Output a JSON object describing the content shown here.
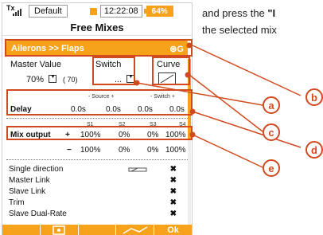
{
  "statusbar": {
    "tx_label": "Tx",
    "model": "Default",
    "time": "12:22:08",
    "battery": "64%"
  },
  "screen_title": "Free Mixes",
  "mix": {
    "name": "Ailerons >> Flaps",
    "suffix": "⊛G"
  },
  "master": {
    "label": "Master Value",
    "value": "70%",
    "extra": "( 70)"
  },
  "switch": {
    "label": "Switch",
    "value": "..."
  },
  "curve": {
    "label": "Curve"
  },
  "delay": {
    "source_header": "- Source +",
    "switch_header": "- Switch +",
    "label": "Delay",
    "values": [
      "0.0s",
      "0.0s",
      "0.0s",
      "0.0s"
    ]
  },
  "mix_output": {
    "headers": [
      "S1",
      "S2",
      "S3",
      "S4"
    ],
    "label": "Mix output",
    "plus_sign": "+",
    "minus_sign": "−",
    "plus": [
      "100%",
      "0%",
      "0%",
      "100%"
    ],
    "minus": [
      "100%",
      "0%",
      "0%",
      "100%"
    ]
  },
  "features": [
    {
      "label": "Single direction",
      "value": "✖"
    },
    {
      "label": "Master Link",
      "value": "✖"
    },
    {
      "label": "Slave Link",
      "value": "✖"
    },
    {
      "label": "Trim",
      "value": "✖"
    },
    {
      "label": "Slave Dual-Rate",
      "value": "✖"
    }
  ],
  "bottombar": {
    "ok": "Ok"
  },
  "callouts": [
    "a",
    "b",
    "c",
    "d",
    "e"
  ],
  "side_text": {
    "line1_prefix": "and press the ",
    "line1_bold": "\"I",
    "line2": "the selected mix"
  },
  "colors": {
    "accent": "#f7a21b",
    "callout": "#d14a1f"
  }
}
